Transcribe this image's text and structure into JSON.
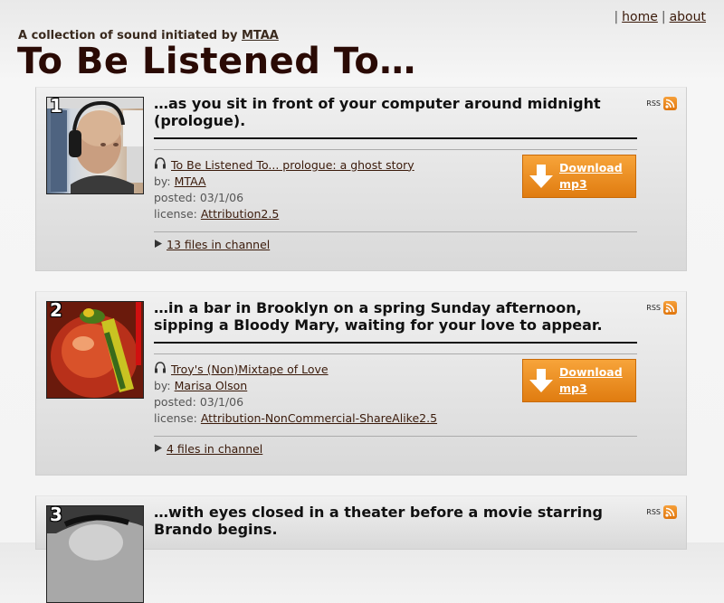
{
  "nav": {
    "sep": "|",
    "home": "home",
    "about": "about"
  },
  "tagline": {
    "text": "A collection of sound initiated by",
    "author": "MTAA"
  },
  "site_title": "To Be Listened To…",
  "channels": [
    {
      "number": "1",
      "title": "…as you sit in front of your computer around midnight (prologue).",
      "rss_label": "RSS",
      "track_title": "To Be Listened To... prologue: a ghost story",
      "by_label": "by:",
      "by": "MTAA",
      "posted_label": "posted:",
      "posted": "03/1/06",
      "license_label": "license:",
      "license": "Attribution2.5",
      "download_line1": "Download",
      "download_line2": "mp3",
      "files": "13 files in channel"
    },
    {
      "number": "2",
      "title": "…in a bar in Brooklyn on a spring Sunday afternoon, sipping a Bloody Mary, waiting for your love to appear.",
      "rss_label": "RSS",
      "track_title": "Troy's (Non)Mixtape of Love",
      "by_label": "by:",
      "by": "Marisa Olson",
      "posted_label": "posted:",
      "posted": "03/1/06",
      "license_label": "license:",
      "license": "Attribution-NonCommercial-ShareAlike2.5",
      "download_line1": "Download",
      "download_line2": "mp3",
      "files": "4 files in channel"
    },
    {
      "number": "3",
      "title": "…with eyes closed in a theater before a movie starring Brando begins.",
      "rss_label": "RSS"
    }
  ],
  "colors": {
    "accent": "#e98a1e",
    "title": "#2a0a04",
    "link": "#3a1a0a"
  },
  "icons": {
    "headphones": "headphones-icon",
    "rss": "rss-icon",
    "download": "download-arrow-icon",
    "expand": "triangle-right-icon"
  }
}
